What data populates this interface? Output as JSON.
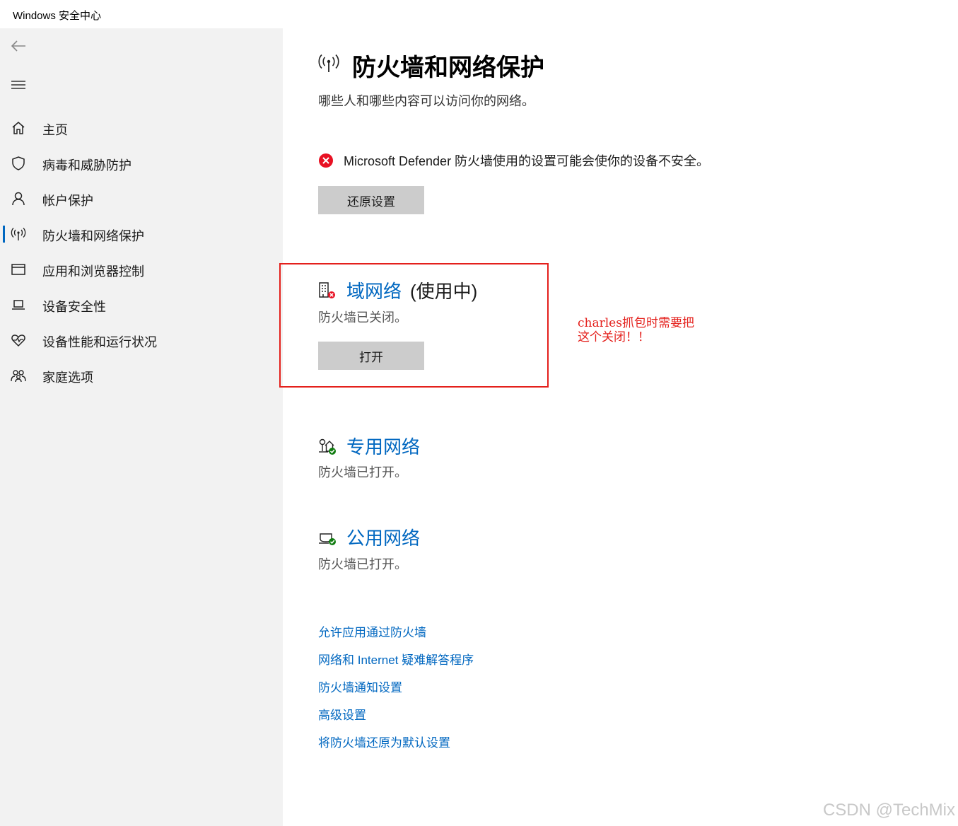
{
  "window": {
    "title": "Windows 安全中心"
  },
  "sidebar": {
    "back_icon": "back-arrow-icon",
    "menu_icon": "hamburger-menu-icon",
    "items": [
      {
        "label": "主页",
        "icon": "home-icon",
        "active": false
      },
      {
        "label": "病毒和威胁防护",
        "icon": "shield-icon",
        "active": false
      },
      {
        "label": "帐户保护",
        "icon": "person-icon",
        "active": false
      },
      {
        "label": "防火墙和网络保护",
        "icon": "antenna-icon",
        "active": true
      },
      {
        "label": "应用和浏览器控制",
        "icon": "browser-window-icon",
        "active": false
      },
      {
        "label": "设备安全性",
        "icon": "laptop-icon",
        "active": false
      },
      {
        "label": "设备性能和运行状况",
        "icon": "heart-pulse-icon",
        "active": false
      },
      {
        "label": "家庭选项",
        "icon": "family-icon",
        "active": false
      }
    ]
  },
  "main": {
    "title": "防火墙和网络保护",
    "subtitle": "哪些人和哪些内容可以访问你的网络。",
    "warning": {
      "text": "Microsoft Defender 防火墙使用的设置可能会使你的设备不安全。",
      "button": "还原设置",
      "icon": "error-circle-icon"
    },
    "networks": [
      {
        "name": "域网络",
        "suffix": "(使用中)",
        "status": "防火墙已关闭。",
        "button": "打开",
        "icon": "domain-network-icon",
        "state": "off"
      },
      {
        "name": "专用网络",
        "suffix": "",
        "status": "防火墙已打开。",
        "icon": "private-network-icon",
        "state": "on"
      },
      {
        "name": "公用网络",
        "suffix": "",
        "status": "防火墙已打开。",
        "icon": "public-network-icon",
        "state": "on"
      }
    ],
    "links": [
      "允许应用通过防火墙",
      "网络和 Internet 疑难解答程序",
      "防火墙通知设置",
      "高级设置",
      "将防火墙还原为默认设置"
    ]
  },
  "annotation": {
    "line1": "charles抓包时需要把",
    "line2": "这个关闭！！"
  },
  "watermark": "CSDN @TechMix",
  "colors": {
    "accent": "#0067c0",
    "error": "#e81123",
    "ok": "#107c10",
    "annotation": "#e4201c",
    "sidebar_bg": "#f2f2f2",
    "button_bg": "#cccccc"
  }
}
